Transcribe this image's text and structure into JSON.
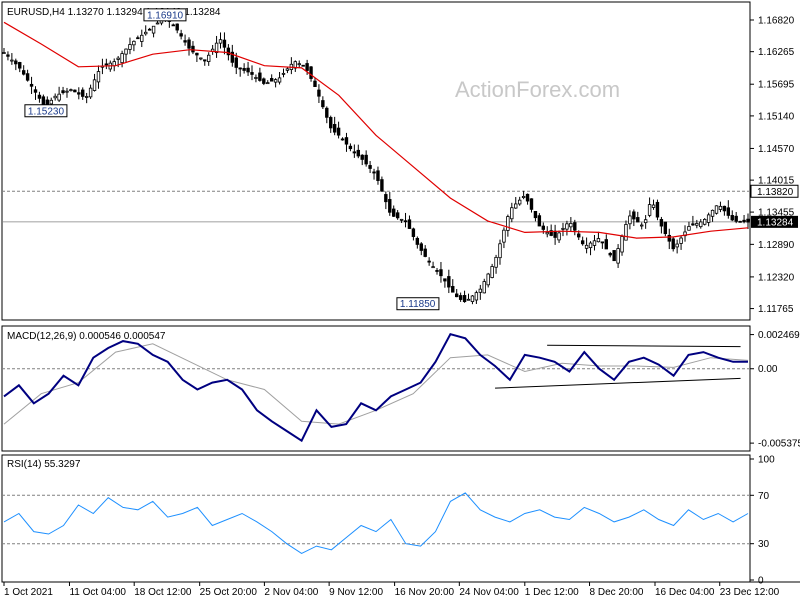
{
  "chart_data": [
    {
      "type": "candlestick",
      "panel": "price",
      "header": "EURUSD,H4  1.13270 1.13294 1.13149 1.13284",
      "watermark": "ActionForex.com",
      "ylim": [
        1.116,
        1.171
      ],
      "y_ticks": [
        "1.16820",
        "1.16265",
        "1.15695",
        "1.15140",
        "1.14570",
        "1.14015",
        "1.13455",
        "1.12890",
        "1.12320",
        "1.11765"
      ],
      "y_tick_values": [
        1.1682,
        1.16265,
        1.15695,
        1.1514,
        1.1457,
        1.14015,
        1.13455,
        1.1289,
        1.1232,
        1.11765
      ],
      "current_price": {
        "label": "1.13284",
        "value": 1.13284
      },
      "resistance_line": {
        "label": "1.13820",
        "value": 1.1382
      },
      "annotations": [
        {
          "label": "1.16910",
          "value": 1.1691,
          "t": 0.215
        },
        {
          "label": "1.15230",
          "value": 1.1523,
          "t": 0.055
        },
        {
          "label": "1.11850",
          "value": 1.1185,
          "t": 0.555
        }
      ],
      "series": [
        {
          "kind": "price",
          "t": [
            0,
            0.02,
            0.04,
            0.055,
            0.07,
            0.09,
            0.11,
            0.13,
            0.15,
            0.17,
            0.19,
            0.205,
            0.215,
            0.23,
            0.25,
            0.27,
            0.285,
            0.29,
            0.31,
            0.33,
            0.35,
            0.37,
            0.39,
            0.405,
            0.42,
            0.44,
            0.45,
            0.47,
            0.48,
            0.5,
            0.52,
            0.54,
            0.555,
            0.57,
            0.59,
            0.6,
            0.61,
            0.62,
            0.64,
            0.66,
            0.68,
            0.7,
            0.72,
            0.74,
            0.76,
            0.78,
            0.8,
            0.82,
            0.84,
            0.86,
            0.87,
            0.88,
            0.9,
            0.92,
            0.94,
            0.96,
            0.98,
            1.0
          ],
          "values": [
            1.1625,
            1.16,
            1.156,
            1.153,
            1.155,
            1.156,
            1.1545,
            1.16,
            1.161,
            1.164,
            1.166,
            1.1675,
            1.1688,
            1.167,
            1.163,
            1.161,
            1.164,
            1.165,
            1.16,
            1.159,
            1.157,
            1.158,
            1.161,
            1.16,
            1.156,
            1.149,
            1.148,
            1.145,
            1.144,
            1.141,
            1.134,
            1.133,
            1.129,
            1.126,
            1.123,
            1.121,
            1.1195,
            1.1188,
            1.121,
            1.126,
            1.135,
            1.1375,
            1.132,
            1.13,
            1.133,
            1.1285,
            1.13,
            1.126,
            1.134,
            1.132,
            1.137,
            1.133,
            1.128,
            1.132,
            1.133,
            1.136,
            1.133,
            1.1328
          ]
        },
        {
          "kind": "moving_average",
          "t": [
            0,
            0.05,
            0.1,
            0.15,
            0.2,
            0.25,
            0.3,
            0.35,
            0.4,
            0.45,
            0.5,
            0.55,
            0.6,
            0.65,
            0.7,
            0.75,
            0.8,
            0.85,
            0.9,
            0.95,
            1.0
          ],
          "values": [
            1.1678,
            1.164,
            1.16,
            1.1602,
            1.1622,
            1.163,
            1.1625,
            1.1602,
            1.1598,
            1.155,
            1.148,
            1.1425,
            1.137,
            1.133,
            1.131,
            1.1312,
            1.131,
            1.13,
            1.1302,
            1.1312,
            1.1318
          ]
        }
      ]
    },
    {
      "type": "line",
      "panel": "macd",
      "header": "MACD(12,26,9) 0.000546 0.000547",
      "ylim": [
        -0.0058,
        0.0028
      ],
      "y_ticks": [
        "0.002469",
        "0.00",
        "-0.005375"
      ],
      "y_tick_values": [
        0.002469,
        0.0,
        -0.005375
      ],
      "series": [
        {
          "kind": "macd",
          "t": [
            0,
            0.02,
            0.04,
            0.06,
            0.08,
            0.1,
            0.12,
            0.14,
            0.16,
            0.18,
            0.2,
            0.22,
            0.24,
            0.26,
            0.28,
            0.3,
            0.32,
            0.34,
            0.36,
            0.38,
            0.4,
            0.42,
            0.44,
            0.46,
            0.48,
            0.5,
            0.52,
            0.54,
            0.56,
            0.58,
            0.6,
            0.62,
            0.64,
            0.66,
            0.68,
            0.7,
            0.72,
            0.74,
            0.76,
            0.78,
            0.8,
            0.82,
            0.84,
            0.86,
            0.88,
            0.9,
            0.92,
            0.94,
            0.96,
            0.98,
            1.0
          ],
          "values": [
            -0.002,
            -0.0012,
            -0.0025,
            -0.0018,
            -0.0005,
            -0.0012,
            0.0008,
            0.0015,
            0.002,
            0.0018,
            0.001,
            0.0005,
            -0.0008,
            -0.0015,
            -0.001,
            -0.0008,
            -0.0015,
            -0.003,
            -0.0038,
            -0.0045,
            -0.0052,
            -0.003,
            -0.0042,
            -0.004,
            -0.0025,
            -0.003,
            -0.002,
            -0.0015,
            -0.001,
            0.0005,
            0.0025,
            0.0022,
            0.001,
            0.0002,
            -0.0008,
            0.001,
            0.0008,
            0.0005,
            -0.0002,
            0.0012,
            0.0,
            -0.0008,
            0.0005,
            0.0008,
            0.0003,
            -0.0005,
            0.001,
            0.0012,
            0.0008,
            0.0005,
            0.0005
          ]
        },
        {
          "kind": "signal",
          "t": [
            0,
            0.05,
            0.1,
            0.15,
            0.2,
            0.25,
            0.3,
            0.35,
            0.4,
            0.45,
            0.5,
            0.55,
            0.6,
            0.65,
            0.7,
            0.75,
            0.8,
            0.85,
            0.9,
            0.95,
            1.0
          ],
          "values": [
            -0.004,
            -0.0018,
            -0.001,
            0.0012,
            0.0018,
            0.0005,
            -0.0008,
            -0.0015,
            -0.0038,
            -0.004,
            -0.003,
            -0.0018,
            0.0008,
            0.001,
            -0.0002,
            0.0004,
            0.0002,
            0.0002,
            0.0001,
            0.0008,
            0.0006
          ]
        }
      ],
      "trendlines": [
        {
          "t": [
            0.73,
            0.99
          ],
          "values": [
            0.0017,
            0.0016
          ]
        },
        {
          "t": [
            0.66,
            0.99
          ],
          "values": [
            -0.0014,
            -0.0007
          ]
        }
      ]
    },
    {
      "type": "line",
      "panel": "rsi",
      "header": "RSI(14) 55.3297",
      "ylim": [
        0,
        100
      ],
      "y_ticks": [
        "100",
        "70",
        "30",
        "0"
      ],
      "y_tick_values": [
        100,
        70,
        30,
        0
      ],
      "levels": [
        70,
        30
      ],
      "series": [
        {
          "kind": "rsi",
          "t": [
            0,
            0.02,
            0.04,
            0.06,
            0.08,
            0.1,
            0.12,
            0.14,
            0.16,
            0.18,
            0.2,
            0.22,
            0.24,
            0.26,
            0.28,
            0.3,
            0.32,
            0.34,
            0.36,
            0.38,
            0.4,
            0.42,
            0.44,
            0.46,
            0.48,
            0.5,
            0.52,
            0.54,
            0.56,
            0.58,
            0.6,
            0.62,
            0.64,
            0.66,
            0.68,
            0.7,
            0.72,
            0.74,
            0.76,
            0.78,
            0.8,
            0.82,
            0.84,
            0.86,
            0.88,
            0.9,
            0.92,
            0.94,
            0.96,
            0.98,
            1.0
          ],
          "values": [
            48,
            55,
            40,
            38,
            45,
            62,
            55,
            68,
            60,
            58,
            65,
            52,
            55,
            60,
            45,
            50,
            55,
            48,
            40,
            30,
            22,
            28,
            25,
            35,
            45,
            40,
            50,
            30,
            28,
            40,
            65,
            72,
            58,
            52,
            48,
            55,
            58,
            52,
            50,
            60,
            55,
            48,
            52,
            58,
            50,
            45,
            58,
            50,
            55,
            48,
            55
          ]
        }
      ]
    }
  ],
  "x_axis": {
    "labels": [
      "1 Oct 2021",
      "11 Oct 04:00",
      "18 Oct 12:00",
      "25 Oct 20:00",
      "2 Nov 04:00",
      "9 Nov 12:00",
      "16 Nov 20:00",
      "24 Nov 04:00",
      "1 Dec 12:00",
      "8 Dec 20:00",
      "16 Dec 04:00",
      "23 Dec 12:00"
    ],
    "positions": [
      0.0,
      0.088,
      0.175,
      0.263,
      0.35,
      0.437,
      0.525,
      0.612,
      0.7,
      0.787,
      0.875,
      0.962
    ]
  },
  "colors": {
    "price": "#000000",
    "moving_average": "#e00000",
    "macd": "#000080",
    "signal": "#a0a0a0",
    "rsi": "#1e90ff",
    "grid_dashed": "#808080",
    "current_price_line": "#808080",
    "current_price_box": "#000000"
  }
}
